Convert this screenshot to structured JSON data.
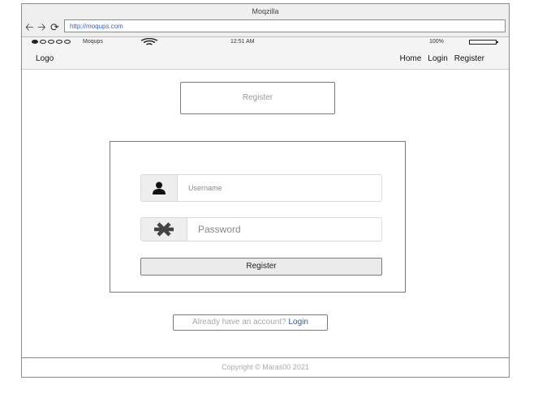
{
  "window": {
    "title": "Moqzilla"
  },
  "browser": {
    "url": "http://moqups.com",
    "back_icon": "arrow-left-icon",
    "forward_icon": "arrow-right-icon",
    "reload_icon": "reload-icon"
  },
  "status": {
    "carrier": "Moqups",
    "time": "12:51 AM",
    "battery": "100%",
    "battery_level": 1.0,
    "signal_dots": 5,
    "signal_filled": 1
  },
  "nav": {
    "logo": "Logo",
    "links": [
      "Home",
      "Login",
      "Register"
    ]
  },
  "top_register": {
    "label": "Register"
  },
  "form": {
    "username_placeholder": "Username",
    "username_value": "",
    "username_icon": "user-icon",
    "password_placeholder": "Password",
    "password_value": "",
    "password_icon": "asterisk-icon",
    "submit_label": "Register"
  },
  "already": {
    "text": "Already have an account?",
    "link": "Login"
  },
  "footer": {
    "text": "Copyright © Maras00 2021"
  },
  "colors": {
    "link": "#2358c5",
    "frame_border": "#8a8a8a",
    "bar_bg": "#f4f4f4"
  }
}
